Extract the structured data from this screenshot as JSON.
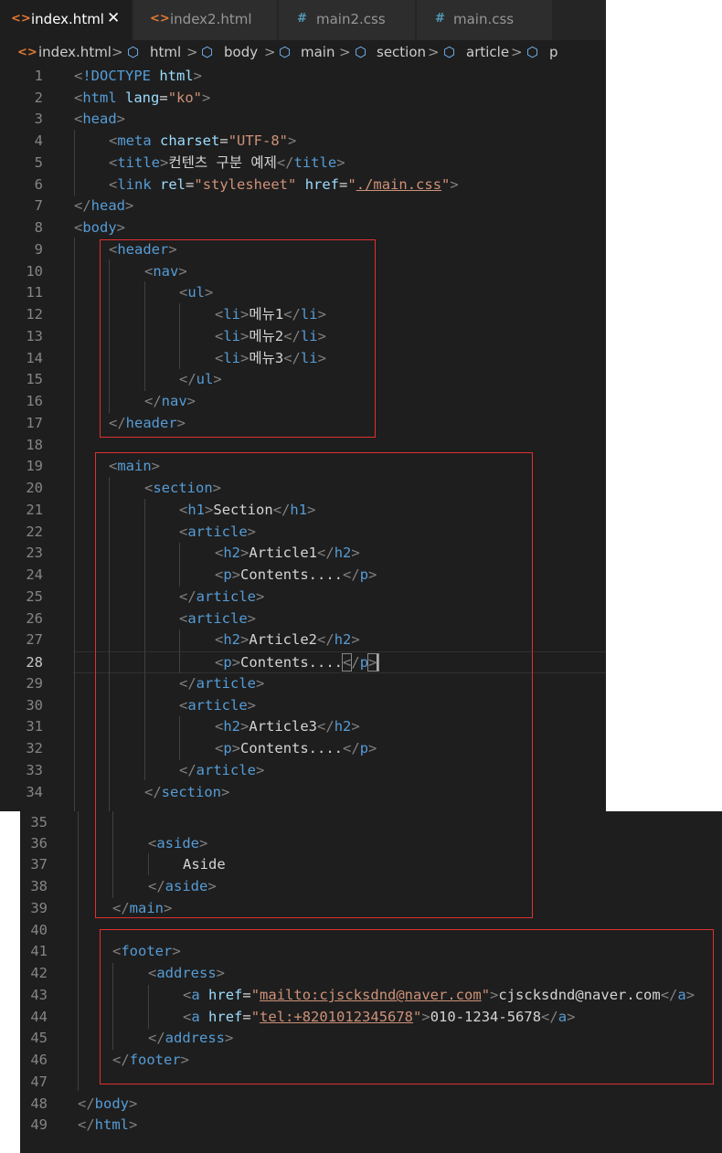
{
  "tabs": [
    {
      "icon": "<>",
      "label": "index.html",
      "close": "✕"
    },
    {
      "icon": "<>",
      "label": "index2.html"
    },
    {
      "icon": "#",
      "label": "main2.css"
    },
    {
      "icon": "#",
      "label": "main.css"
    }
  ],
  "breadcrumb": {
    "file": "index.html",
    "items": [
      "html",
      "body",
      "main",
      "section",
      "article",
      "p"
    ],
    "file_icon": "<>",
    "separator": ">"
  },
  "line_numbers": [
    "1",
    "2",
    "3",
    "4",
    "5",
    "6",
    "7",
    "8",
    "9",
    "10",
    "11",
    "12",
    "13",
    "14",
    "15",
    "16",
    "17",
    "18",
    "19",
    "20",
    "21",
    "22",
    "23",
    "24",
    "25",
    "26",
    "27",
    "28",
    "29",
    "30",
    "31",
    "32",
    "33",
    "34",
    "35",
    "36",
    "37",
    "38",
    "39",
    "40",
    "41",
    "42",
    "43",
    "44",
    "45",
    "46",
    "47",
    "48",
    "49"
  ],
  "code": {
    "doctype": "!DOCTYPE",
    "html": "html",
    "lang_attr": "lang",
    "lang_val": "\"ko\"",
    "head": "head",
    "meta": "meta",
    "charset_attr": "charset",
    "charset_val": "\"UTF-8\"",
    "title": "title",
    "title_text": "컨텐츠 구분 예제",
    "link": "link",
    "rel_attr": "rel",
    "rel_val": "\"stylesheet\"",
    "href_attr": "href",
    "quote": "\"",
    "href_css": "./main.css",
    "body": "body",
    "header": "header",
    "nav": "nav",
    "ul": "ul",
    "li": "li",
    "menu1": "메뉴1",
    "menu2": "메뉴2",
    "menu3": "메뉴3",
    "main": "main",
    "section": "section",
    "h1": "h1",
    "section_text": "Section",
    "article": "article",
    "h2": "h2",
    "article1": "Article1",
    "article2": "Article2",
    "article3": "Article3",
    "p": "p",
    "contents": "Contents....",
    "aside": "aside",
    "aside_text": "Aside",
    "footer": "footer",
    "address": "address",
    "a": "a",
    "mailto": "mailto:cjscksdnd@naver.com",
    "email_text": "cjscksdnd@naver.com",
    "tel": "tel:+8201012345678",
    "phone_text": "010-1234-5678"
  },
  "colors": {
    "editor_bg": "#1e1e1e",
    "tag": "#569cd6",
    "attribute": "#9cdcfe",
    "string": "#ce9178",
    "punctuation": "#808080",
    "annotation_box": "#e03030"
  }
}
